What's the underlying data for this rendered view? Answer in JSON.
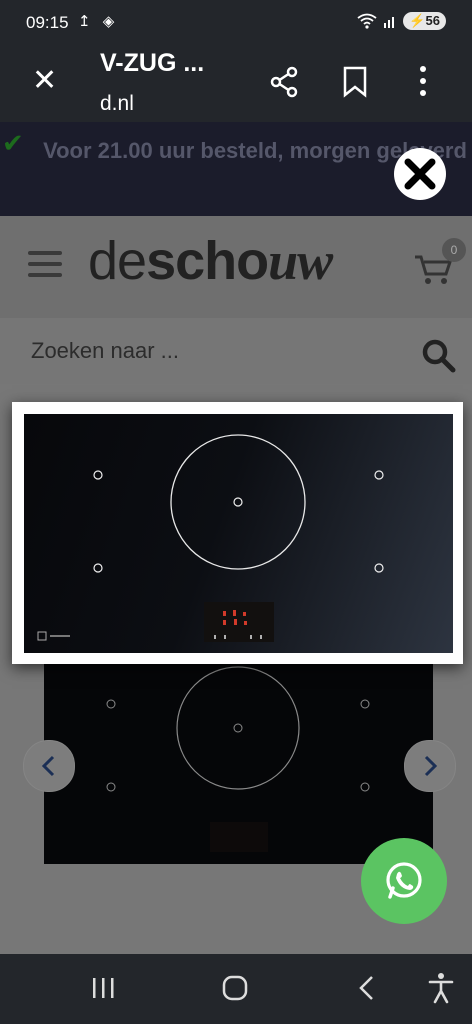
{
  "status": {
    "time": "09:15",
    "battery": "56"
  },
  "toolbar": {
    "title": "V-ZUG ...",
    "url": "d.nl"
  },
  "banner": {
    "text": "Voor 21.00 uur besteld, morgen geleverd"
  },
  "header": {
    "logo_thin": "de",
    "logo_bold": "scho",
    "logo_ital": "uw",
    "cart_count": "0"
  },
  "search": {
    "placeholder": "Zoeken naar ..."
  },
  "colors": {
    "whatsapp": "#5bc462",
    "bar_dark": "#23262b",
    "banner": "#1b1c2b"
  }
}
